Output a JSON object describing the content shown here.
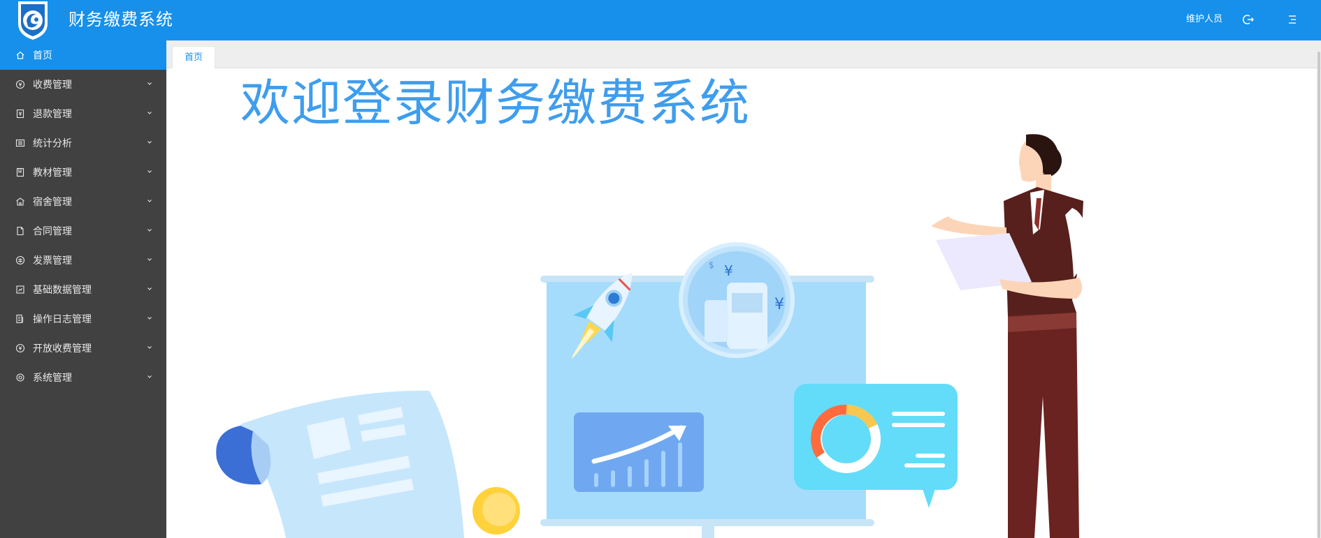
{
  "header": {
    "app_title": "财务缴费系统",
    "user_name": "维护人员",
    "logout_icon": "logout-icon",
    "menu_icon": "menu-icon",
    "background": "#1690ea"
  },
  "sidebar": {
    "background": "#414141",
    "items": [
      {
        "label": "首页",
        "icon": "home-icon",
        "active": true
      },
      {
        "label": "收费管理",
        "icon": "yuan-circle-icon"
      },
      {
        "label": "退款管理",
        "icon": "refund-icon"
      },
      {
        "label": "统计分析",
        "icon": "list-icon"
      },
      {
        "label": "教材管理",
        "icon": "book-icon"
      },
      {
        "label": "宿舍管理",
        "icon": "building-icon"
      },
      {
        "label": "合同管理",
        "icon": "document-icon"
      },
      {
        "label": "发票管理",
        "icon": "invoice-icon"
      },
      {
        "label": "基础数据管理",
        "icon": "data-icon"
      },
      {
        "label": "操作日志管理",
        "icon": "log-icon"
      },
      {
        "label": "开放收费管理",
        "icon": "yuan-circle-icon"
      },
      {
        "label": "系统管理",
        "icon": "gear-icon"
      }
    ]
  },
  "tabs": [
    {
      "label": "首页",
      "active": true
    }
  ],
  "main": {
    "welcome_text": "欢迎登录财务缴费系统",
    "accent_color": "#3f9ded"
  }
}
